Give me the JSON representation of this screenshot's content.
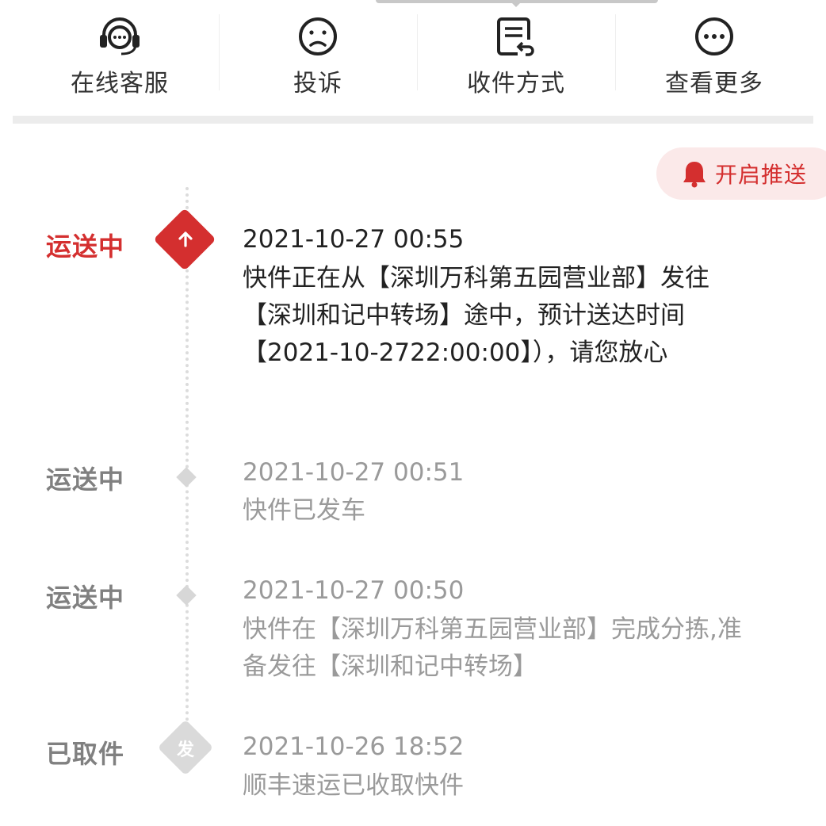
{
  "actions": [
    {
      "label": "在线客服",
      "icon": "headset-icon"
    },
    {
      "label": "投诉",
      "icon": "frown-face-icon"
    },
    {
      "label": "收件方式",
      "icon": "receipt-return-icon"
    },
    {
      "label": "查看更多",
      "icon": "more-dots-icon"
    }
  ],
  "push": {
    "label": "开启推送",
    "icon": "bell-icon"
  },
  "events": [
    {
      "status": "运送中",
      "time": "2021-10-27 00:55",
      "desc": "快件正在从【深圳万科第五园营业部】发往【深圳和记中转场】途中，预计送达时间【2021-10-2722:00:00】），请您放心",
      "state": "current",
      "node_icon": "arrow-up-icon"
    },
    {
      "status": "运送中",
      "time": "2021-10-27 00:51",
      "desc": "快件已发车",
      "state": "past"
    },
    {
      "status": "运送中",
      "time": "2021-10-27 00:50",
      "desc": "快件在【深圳万科第五园营业部】完成分拣,准备发往【深圳和记中转场】",
      "state": "past"
    },
    {
      "status": "已取件",
      "time": "2021-10-26 18:52",
      "desc": "顺丰速运已收取快件",
      "state": "past",
      "node_label": "发"
    }
  ],
  "colors": {
    "accent": "#d42f2f",
    "muted": "#9a9a9a",
    "node": "#d7d7d7"
  }
}
